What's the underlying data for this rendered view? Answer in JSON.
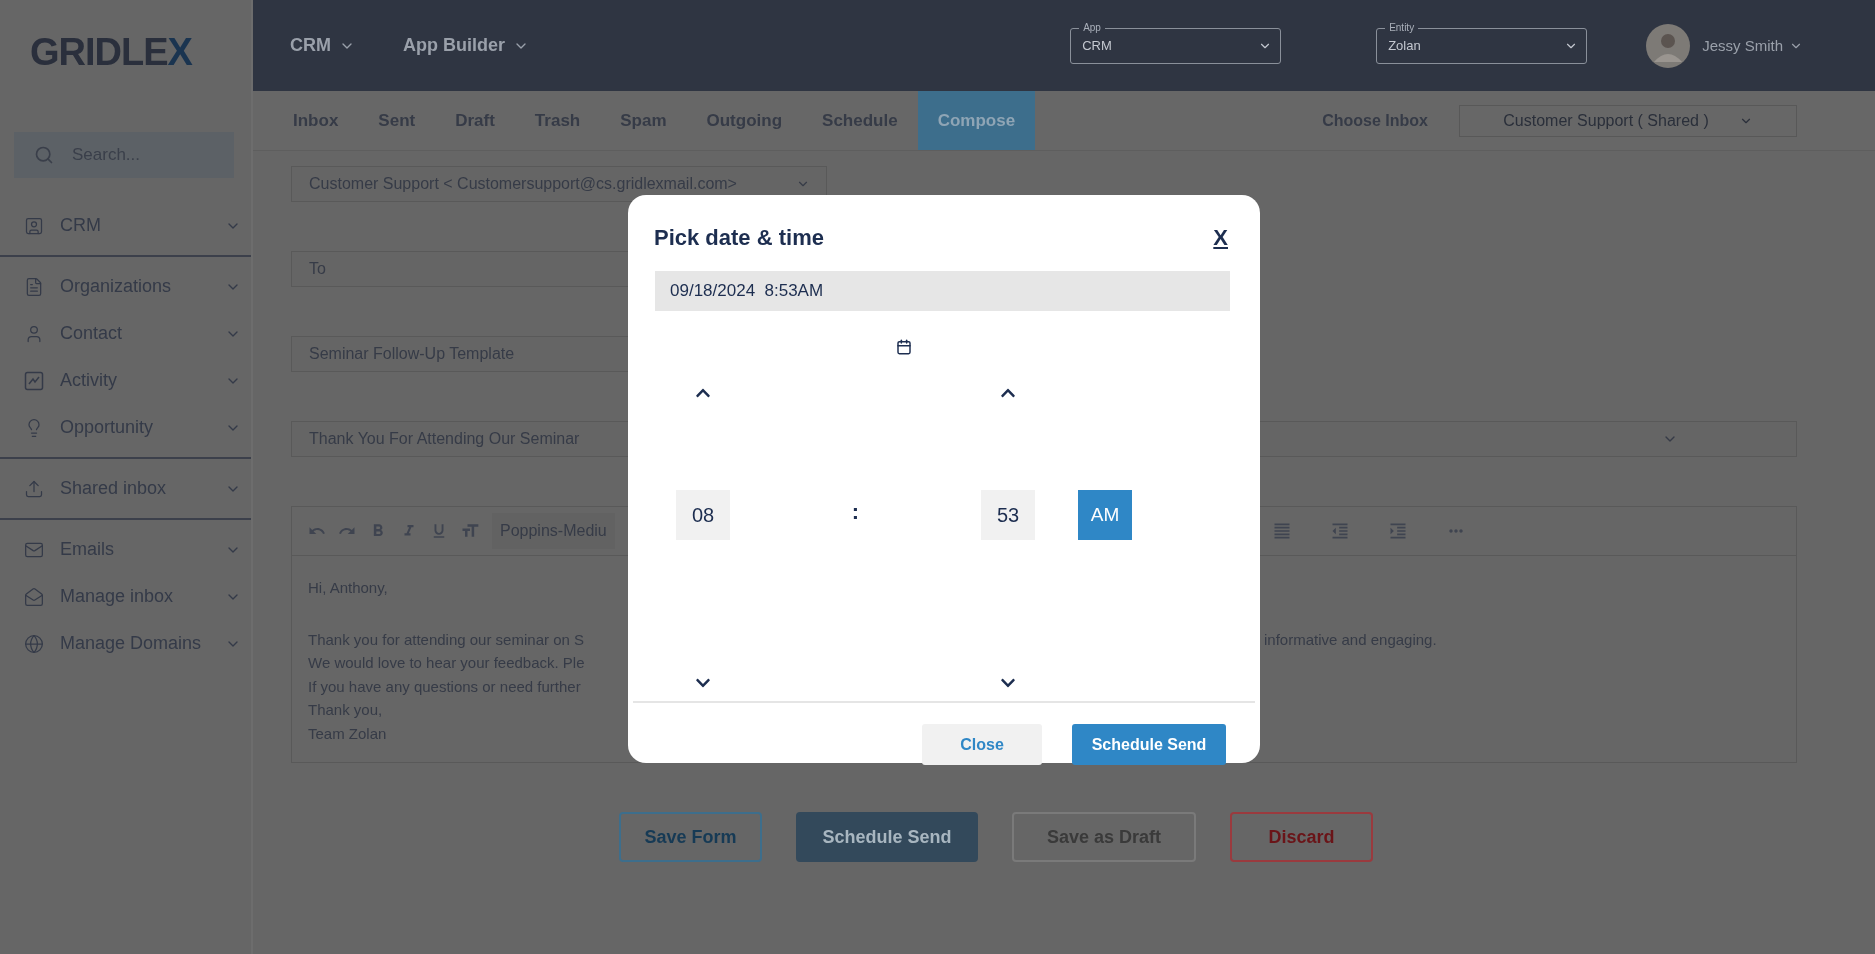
{
  "logo": {
    "text": "GRIDLE",
    "accent": "X"
  },
  "header": {
    "menus": [
      {
        "label": "CRM"
      },
      {
        "label": "App Builder"
      }
    ],
    "selects": [
      {
        "legend": "App",
        "value": "CRM"
      },
      {
        "legend": "Entity",
        "value": "Zolan"
      }
    ],
    "user": {
      "name": "Jessy Smith"
    }
  },
  "sidebar": {
    "search": {
      "placeholder": "Search..."
    },
    "groups": [
      [
        {
          "label": "CRM"
        }
      ],
      [
        {
          "label": "Organizations"
        },
        {
          "label": "Contact"
        },
        {
          "label": "Activity"
        },
        {
          "label": "Opportunity"
        }
      ],
      [
        {
          "label": "Shared inbox"
        }
      ],
      [
        {
          "label": "Emails"
        },
        {
          "label": "Manage inbox"
        },
        {
          "label": "Manage Domains"
        }
      ]
    ]
  },
  "tabs": [
    {
      "label": "Inbox",
      "selected": false
    },
    {
      "label": "Sent",
      "selected": false
    },
    {
      "label": "Draft",
      "selected": false
    },
    {
      "label": "Trash",
      "selected": false
    },
    {
      "label": "Spam",
      "selected": false
    },
    {
      "label": "Outgoing",
      "selected": false
    },
    {
      "label": "Schedule",
      "selected": false
    },
    {
      "label": "Compose",
      "selected": true
    }
  ],
  "choose_inbox": {
    "label": "Choose Inbox",
    "value": "Customer Support ( Shared )"
  },
  "compose": {
    "from": "Customer Support < Customersupport@cs.gridlexmail.com>",
    "to": {
      "placeholder": "To"
    },
    "template": "Seminar Follow-Up Template",
    "subject": "Thank You For Attending Our Seminar",
    "font": "Poppins-Mediu",
    "greeting": "Hi, Anthony,",
    "lines": [
      {
        "left": "Thank you for attending our seminar on S",
        "right": "informative and engaging."
      },
      {
        "left": "We would love to hear your feedback. Ple"
      },
      {
        "left": "If you have any questions or need further"
      },
      {
        "left": "Thank you,"
      },
      {
        "left": "Team Zolan"
      }
    ]
  },
  "actions": [
    {
      "label": "Save Form",
      "kind": "outline"
    },
    {
      "label": "Schedule Send",
      "kind": "primary"
    },
    {
      "label": "Save as Draft",
      "kind": "muted"
    },
    {
      "label": "Discard",
      "kind": "danger"
    }
  ],
  "dialog": {
    "title": "Pick date & time",
    "close": "X",
    "value": "09/18/2024  8:53AM",
    "hours": "08",
    "separator": ":",
    "minutes": "53",
    "period": "AM",
    "buttons": [
      {
        "label": "Close",
        "kind": "secondary"
      },
      {
        "label": "Schedule Send",
        "kind": "primary"
      }
    ]
  }
}
